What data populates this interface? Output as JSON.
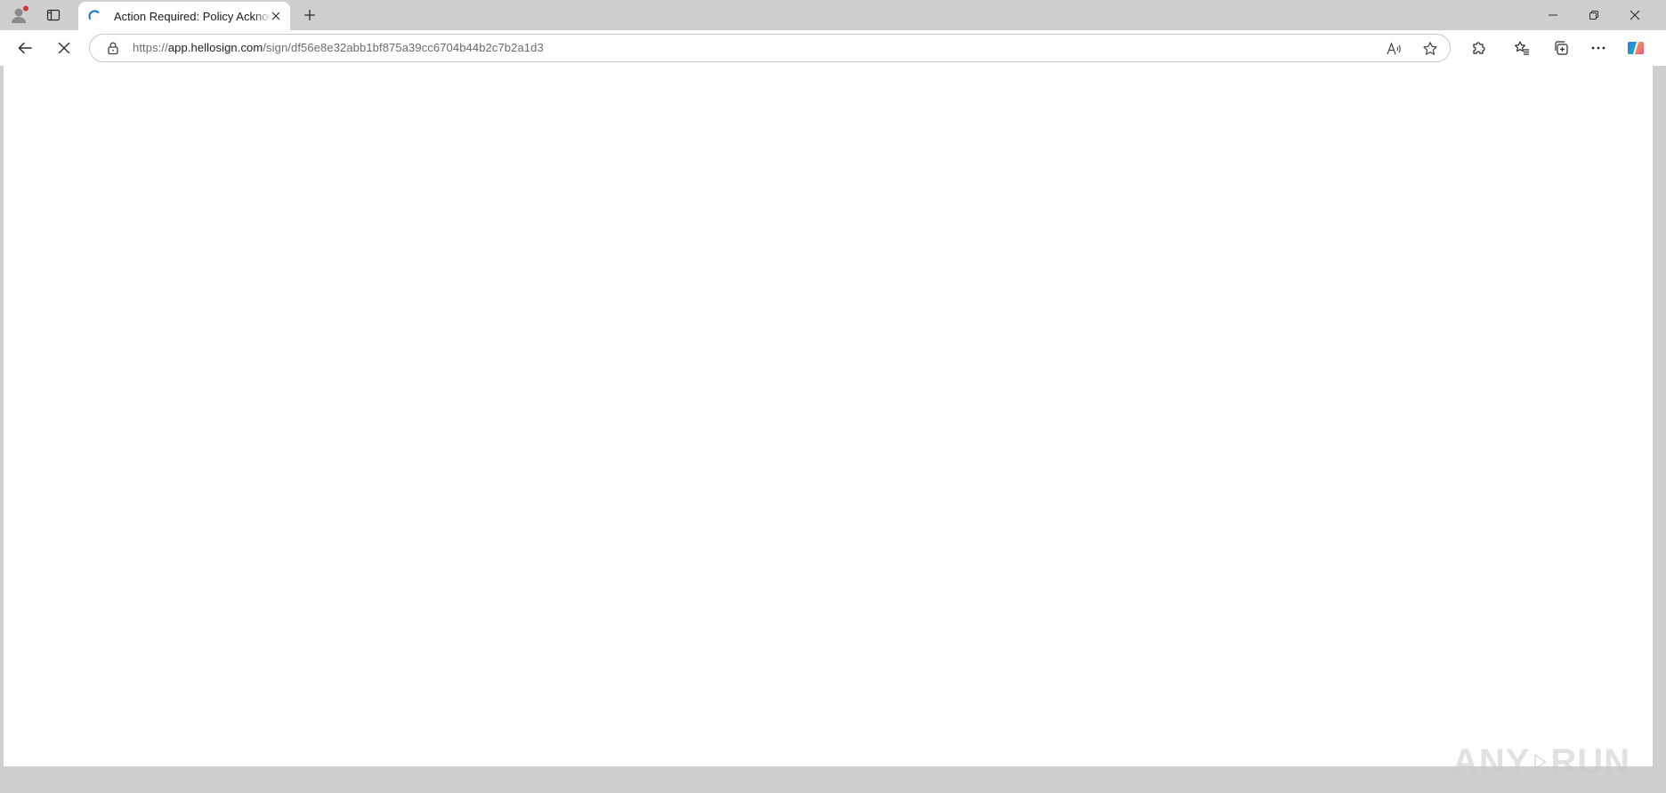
{
  "browser": {
    "tab": {
      "title": "Action Required: Policy Acknowledgement",
      "loading": true
    },
    "address_bar": {
      "scheme": "https://",
      "host": "app.hellosign.com",
      "path": "/sign/df56e8e32abb1bf875a39cc6704b44b2c7b2a1d3"
    },
    "icons": {
      "profile": "profile-icon",
      "tab_actions": "tab-actions-icon",
      "new_tab": "plus-icon",
      "back": "back-arrow-icon",
      "stop": "stop-loading-icon",
      "lock": "lock-icon",
      "read_aloud": "read-aloud-icon",
      "favorite_add": "star-icon",
      "extensions": "puzzle-icon",
      "favorites": "favorites-icon",
      "collections": "collections-icon",
      "more": "ellipsis-icon",
      "copilot": "copilot-icon"
    },
    "colors": {
      "tabstrip": "#cfcfcf",
      "spinner": "#1a73c7",
      "profile_badge": "#d13438"
    }
  },
  "watermark": {
    "left": "ANY",
    "right": "RUN"
  }
}
